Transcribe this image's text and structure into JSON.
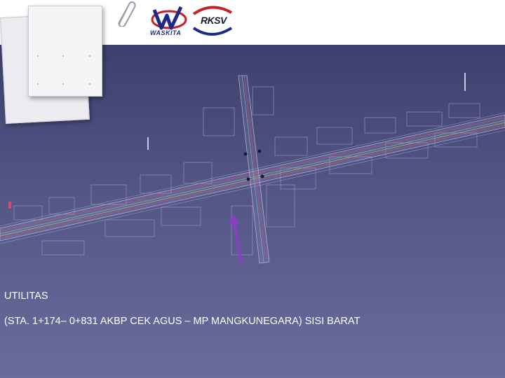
{
  "logos": {
    "waskita": "WASKITA",
    "rksv": "RKSV"
  },
  "icons": {
    "paperclip": "paperclip-icon"
  },
  "colors": {
    "background": "#4a4c7a",
    "caption_text": "#ffffff",
    "arrow": "#8a3fc0"
  },
  "caption": {
    "line1": "UTILITAS",
    "line2": "(STA. 1+174– 0+831 AKBP CEK AGUS – MP MANGKUNEGARA) SISI BARAT"
  }
}
